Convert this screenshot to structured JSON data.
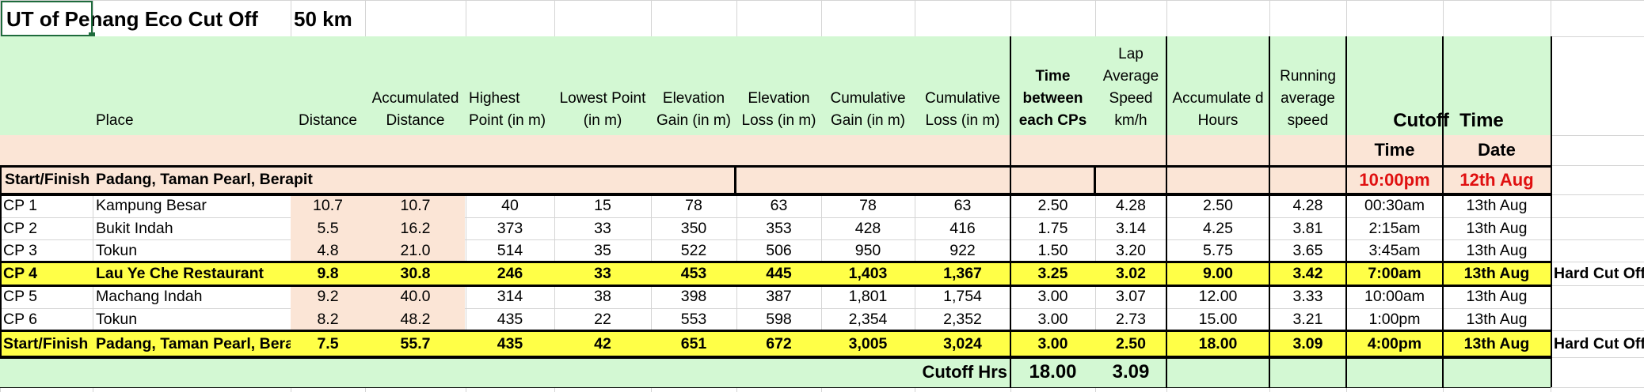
{
  "title": "UT of Penang Eco Cut Off",
  "distance_label": "50 km",
  "headers": {
    "place": "Place",
    "distance": "Distance",
    "accumulated_distance": "Accumulated Distance",
    "highest_point": "Highest Point (in m)",
    "lowest_point": "Lowest Point (in m)",
    "elevation_gain": "Elevation Gain (in m)",
    "elevation_loss": "Elevation Loss (in m)",
    "cumulative_gain": "Cumulative Gain (in m)",
    "cumulative_loss": "Cumulative Loss (in m)",
    "time_between": "Time between each CPs",
    "lap_speed": "Lap Average Speed km/h",
    "accumulated_hours": "Accumulate d Hours",
    "running_avg": "Running average speed",
    "cutoff_time": "Cutoff  Time",
    "time": "Time",
    "date": "Date"
  },
  "start": {
    "cp": "Start/Finish",
    "place": "Padang, Taman Pearl, Berapit",
    "time": "10:00pm",
    "date": "12th Aug"
  },
  "rows": [
    {
      "cp": "CP 1",
      "place": "Kampung Besar",
      "dist": "10.7",
      "acc": "10.7",
      "high": "40",
      "low": "15",
      "gain": "78",
      "loss": "63",
      "cgain": "78",
      "closs": "63",
      "tbetween": "2.50",
      "lap": "4.28",
      "acchrs": "2.50",
      "running": "4.28",
      "time": "00:30am",
      "date": "13th Aug",
      "note": ""
    },
    {
      "cp": "CP 2",
      "place": "Bukit Indah",
      "dist": "5.5",
      "acc": "16.2",
      "high": "373",
      "low": "33",
      "gain": "350",
      "loss": "353",
      "cgain": "428",
      "closs": "416",
      "tbetween": "1.75",
      "lap": "3.14",
      "acchrs": "4.25",
      "running": "3.81",
      "time": "2:15am",
      "date": "13th Aug",
      "note": ""
    },
    {
      "cp": "CP 3",
      "place": "Tokun",
      "dist": "4.8",
      "acc": "21.0",
      "high": "514",
      "low": "35",
      "gain": "522",
      "loss": "506",
      "cgain": "950",
      "closs": "922",
      "tbetween": "1.50",
      "lap": "3.20",
      "acchrs": "5.75",
      "running": "3.65",
      "time": "3:45am",
      "date": "13th Aug",
      "note": ""
    },
    {
      "cp": "CP 4",
      "place": "Lau Ye Che Restaurant",
      "dist": "9.8",
      "acc": "30.8",
      "high": "246",
      "low": "33",
      "gain": "453",
      "loss": "445",
      "cgain": "1,403",
      "closs": "1,367",
      "tbetween": "3.25",
      "lap": "3.02",
      "acchrs": "9.00",
      "running": "3.42",
      "time": "7:00am",
      "date": "13th Aug",
      "note": "Hard Cut Off"
    },
    {
      "cp": "CP 5",
      "place": "Machang Indah",
      "dist": "9.2",
      "acc": "40.0",
      "high": "314",
      "low": "38",
      "gain": "398",
      "loss": "387",
      "cgain": "1,801",
      "closs": "1,754",
      "tbetween": "3.00",
      "lap": "3.07",
      "acchrs": "12.00",
      "running": "3.33",
      "time": "10:00am",
      "date": "13th Aug",
      "note": ""
    },
    {
      "cp": "CP 6",
      "place": "Tokun",
      "dist": "8.2",
      "acc": "48.2",
      "high": "435",
      "low": "22",
      "gain": "553",
      "loss": "598",
      "cgain": "2,354",
      "closs": "2,352",
      "tbetween": "3.00",
      "lap": "2.73",
      "acchrs": "15.00",
      "running": "3.21",
      "time": "1:00pm",
      "date": "13th Aug",
      "note": ""
    },
    {
      "cp": "Start/Finish",
      "place": "Padang, Taman Pearl, Berapit",
      "dist": "7.5",
      "acc": "55.7",
      "high": "435",
      "low": "42",
      "gain": "651",
      "loss": "672",
      "cgain": "3,005",
      "closs": "3,024",
      "tbetween": "3.00",
      "lap": "2.50",
      "acchrs": "18.00",
      "running": "3.09",
      "time": "4:00pm",
      "date": "13th Aug",
      "note": "Hard Cut Off"
    }
  ],
  "footer": {
    "label": "Cutoff Hrs",
    "hours": "18.00",
    "speed": "3.09"
  },
  "colors": {
    "green": "#d3f8d3",
    "peach": "#fbe5d6",
    "yellow": "#ffff47",
    "red": "#e01010",
    "selection": "#1e6b3c"
  }
}
